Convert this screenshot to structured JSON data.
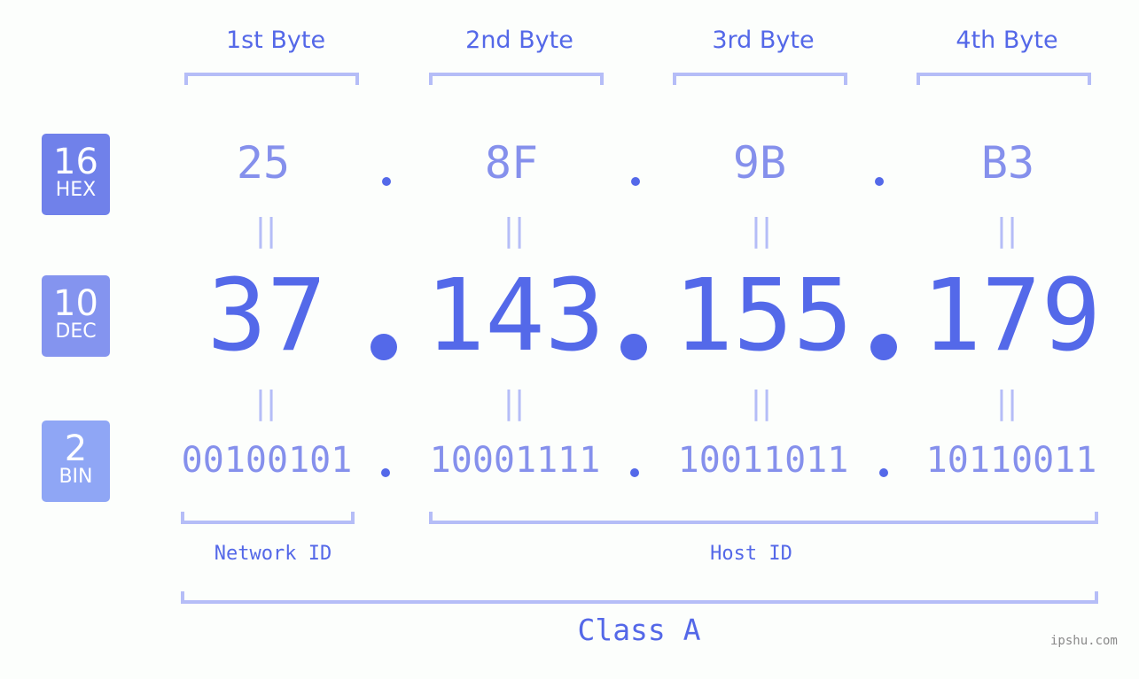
{
  "badges": [
    {
      "base": "16",
      "label": "HEX",
      "color": "#7081ea"
    },
    {
      "base": "10",
      "label": "DEC",
      "color": "#8494ef"
    },
    {
      "base": "2",
      "label": "BIN",
      "color": "#8fa6f5"
    }
  ],
  "byte_headers": [
    "1st Byte",
    "2nd Byte",
    "3rd Byte",
    "4th Byte"
  ],
  "hex": [
    "25",
    "8F",
    "9B",
    "B3"
  ],
  "dec": [
    "37",
    "143",
    "155",
    "179"
  ],
  "bin": [
    "00100101",
    "10001111",
    "10011011",
    "10110011"
  ],
  "equals_glyph": "||",
  "network_id_label": "Network ID",
  "host_id_label": "Host ID",
  "class_label": "Class A",
  "watermark": "ipshu.com",
  "colors": {
    "primary": "#5469e9",
    "secondary": "#8590ec",
    "bracket": "#b5bdf7"
  }
}
